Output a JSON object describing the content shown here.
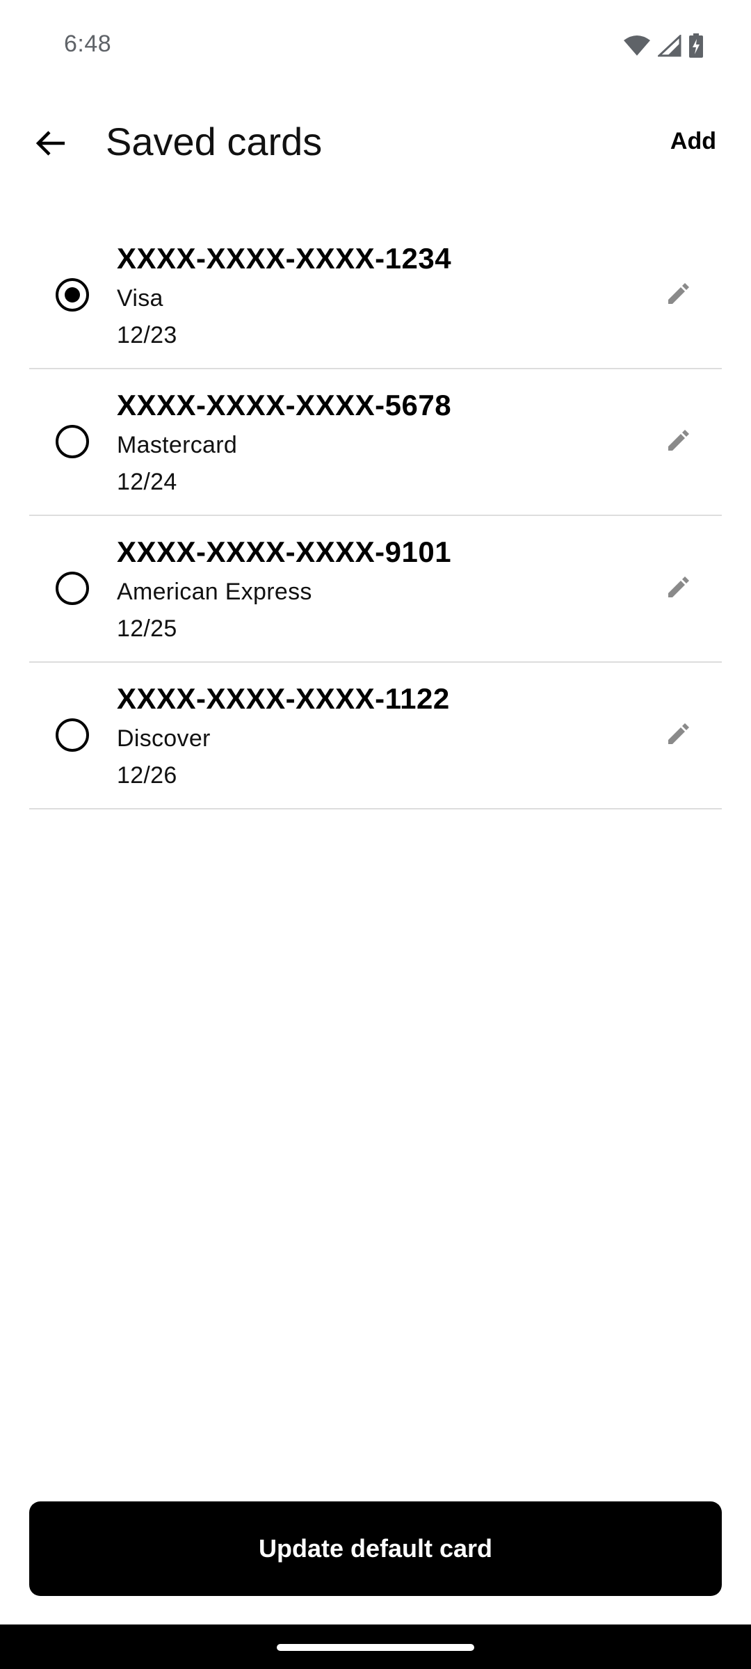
{
  "status_bar": {
    "time": "6:48",
    "icons": [
      "wifi-icon",
      "cell-signal-icon",
      "battery-charging-icon"
    ]
  },
  "app_bar": {
    "title": "Saved cards",
    "back_icon": "arrow-back-icon",
    "add_label": "Add"
  },
  "cards": [
    {
      "number": "XXXX-XXXX-XXXX-1234",
      "brand": "Visa",
      "expiry": "12/23",
      "selected": true
    },
    {
      "number": "XXXX-XXXX-XXXX-5678",
      "brand": "Mastercard",
      "expiry": "12/24",
      "selected": false
    },
    {
      "number": "XXXX-XXXX-XXXX-9101",
      "brand": "American Express",
      "expiry": "12/25",
      "selected": false
    },
    {
      "number": "XXXX-XXXX-XXXX-1122",
      "brand": "Discover",
      "expiry": "12/26",
      "selected": false
    }
  ],
  "footer": {
    "update_label": "Update default card"
  },
  "colors": {
    "primary": "#000000",
    "background": "#ffffff",
    "divider": "#dddddd",
    "edit_icon": "#8a8a8a",
    "status_text": "#5f6368"
  }
}
